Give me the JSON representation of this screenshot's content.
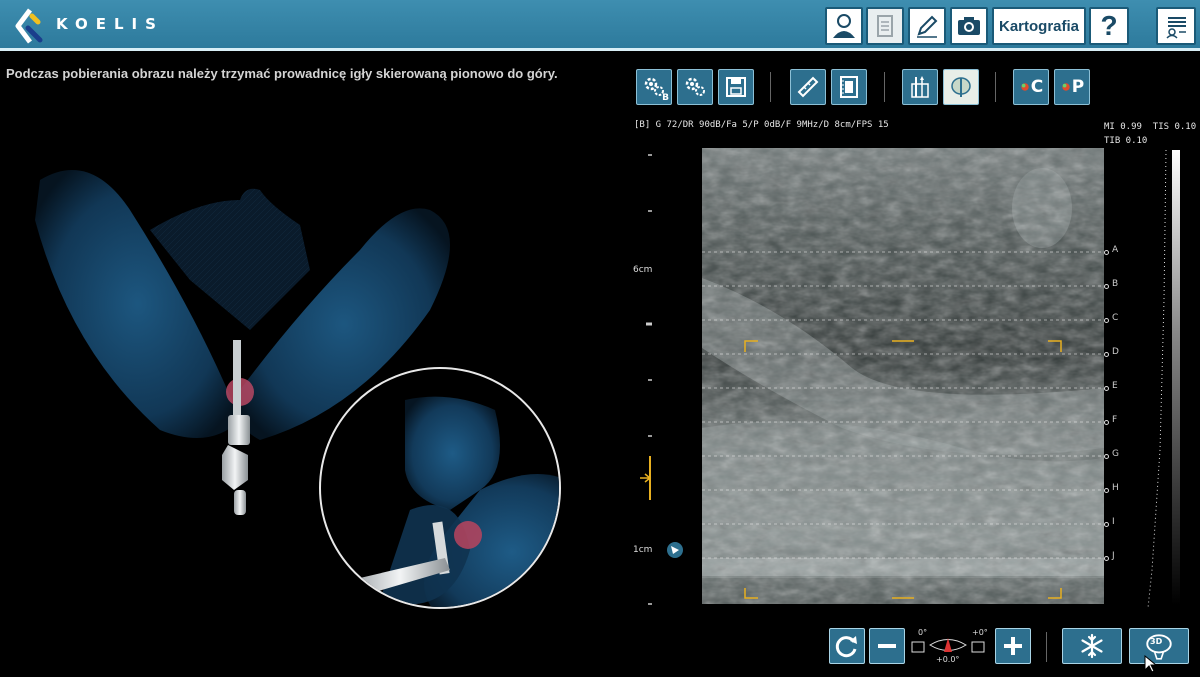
{
  "header": {
    "brand": "KOELIS",
    "buttons": [
      {
        "name": "patient-button",
        "icon": "user-icon"
      },
      {
        "name": "report-button",
        "icon": "document-icon"
      },
      {
        "name": "edit-button",
        "icon": "pencil-icon"
      },
      {
        "name": "camera-button",
        "icon": "camera-icon"
      },
      {
        "name": "mapping-button",
        "label": "Kartografia"
      },
      {
        "name": "help-button",
        "label": "?"
      },
      {
        "name": "checklist-button",
        "icon": "checklist-icon"
      }
    ]
  },
  "instruction": "Podczas pobierania obrazu należy trzymać prowadnicę igły skierowaną pionowo do góry.",
  "toolbar": {
    "buttons": [
      {
        "name": "settings-b-button",
        "sub": "B"
      },
      {
        "name": "settings-presets-button",
        "sub": ""
      },
      {
        "name": "save-button",
        "sub": ""
      },
      {
        "name": "measure-button",
        "sub": ""
      },
      {
        "name": "cine-button",
        "sub": ""
      },
      {
        "name": "biopsy-guide-button",
        "sub": ""
      },
      {
        "name": "prostate-contour-button",
        "sub": ""
      },
      {
        "name": "color-mode-c-button",
        "label": "C"
      },
      {
        "name": "color-mode-p-button",
        "label": "P"
      }
    ]
  },
  "ultrasound": {
    "params": "[B] G 72/DR 90dB/Fa 5/P 0dB/F 9MHz/D 8cm/FPS 15",
    "mi": "MI 0.99",
    "tis": "TIS 0.10",
    "tib": "TIB 0.10",
    "scale_top": "6cm",
    "scale_bottom": "1cm",
    "rows": [
      "A",
      "B",
      "C",
      "D",
      "E",
      "F",
      "G",
      "H",
      "I",
      "J"
    ]
  },
  "controls": {
    "angle_left": "0°",
    "angle_right": "+0°",
    "angle_value": "+0.0°",
    "volume_label": "3D"
  },
  "colors": {
    "accent": "#2d6f8e",
    "header": "#3a89ab",
    "marker": "#e8b020"
  }
}
